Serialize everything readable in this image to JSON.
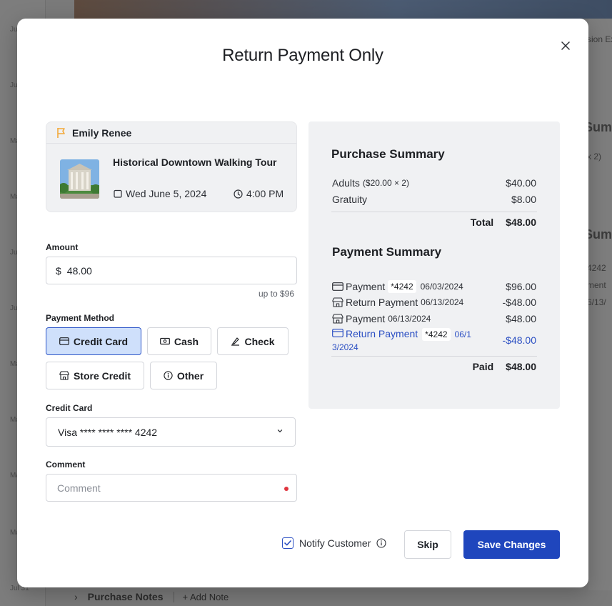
{
  "background": {
    "dates": [
      "Jul 1",
      "Jul 5",
      "May",
      "May",
      "Jul",
      "Jul",
      "May",
      "May",
      "May",
      "May",
      "Jul 31"
    ],
    "right_labels": [
      "sion Ex",
      "Sum",
      "x 2)",
      "Sum",
      "4242",
      "ment",
      "6/13/"
    ],
    "bottom": {
      "purchase_notes": "Purchase Notes",
      "add_note": "Add Note"
    }
  },
  "modal": {
    "title": "Return Payment Only",
    "close_icon": "close-icon"
  },
  "booking": {
    "customer_name": "Emily Renee",
    "tour_name": "Historical Downtown Walking Tour",
    "date": "Wed June 5, 2024",
    "time": "4:00 PM"
  },
  "form": {
    "amount_label": "Amount",
    "currency_symbol": "$",
    "amount_value": "48.00",
    "amount_hint": "up to $96",
    "payment_method_label": "Payment Method",
    "payment_methods": [
      {
        "label": "Credit Card",
        "icon": "credit-card-icon",
        "selected": true
      },
      {
        "label": "Cash",
        "icon": "cash-icon",
        "selected": false
      },
      {
        "label": "Check",
        "icon": "check-icon",
        "selected": false
      },
      {
        "label": "Store Credit",
        "icon": "store-icon",
        "selected": false
      },
      {
        "label": "Other",
        "icon": "info-icon",
        "selected": false
      }
    ],
    "credit_card_label": "Credit Card",
    "credit_card_value": "Visa **** **** **** 4242",
    "comment_label": "Comment",
    "comment_placeholder": "Comment"
  },
  "purchase_summary": {
    "title": "Purchase Summary",
    "items": [
      {
        "label": "Adults",
        "detail": "($20.00 × 2)",
        "amount": "$40.00"
      },
      {
        "label": "Gratuity",
        "detail": "",
        "amount": "$8.00"
      }
    ],
    "total_label": "Total",
    "total_amount": "$48.00"
  },
  "payment_summary": {
    "title": "Payment Summary",
    "rows": [
      {
        "icon": "credit-card-icon",
        "label": "Payment",
        "card": "*4242",
        "date": "06/03/2024",
        "amount": "$96.00"
      },
      {
        "icon": "store-icon",
        "label": "Return Payment",
        "card": "",
        "date": "06/13/2024",
        "amount": "-$48.00"
      },
      {
        "icon": "store-icon",
        "label": "Payment",
        "card": "",
        "date": "06/13/2024",
        "amount": "$48.00"
      },
      {
        "icon": "credit-card-icon",
        "label": "Return Payment",
        "card": "*4242",
        "date_part1": "06/1",
        "date_part2": "3/2024",
        "amount": "-$48.00"
      }
    ],
    "paid_label": "Paid",
    "paid_amount": "$48.00"
  },
  "footer": {
    "notify_label": "Notify Customer",
    "notify_checked": true,
    "skip_label": "Skip",
    "save_label": "Save Changes"
  },
  "colors": {
    "primary": "#1f46bd",
    "selected_bg": "#cfe0fb",
    "link_blue": "#2b4fc3",
    "flag": "#f2a93b",
    "required": "#e0353f"
  }
}
